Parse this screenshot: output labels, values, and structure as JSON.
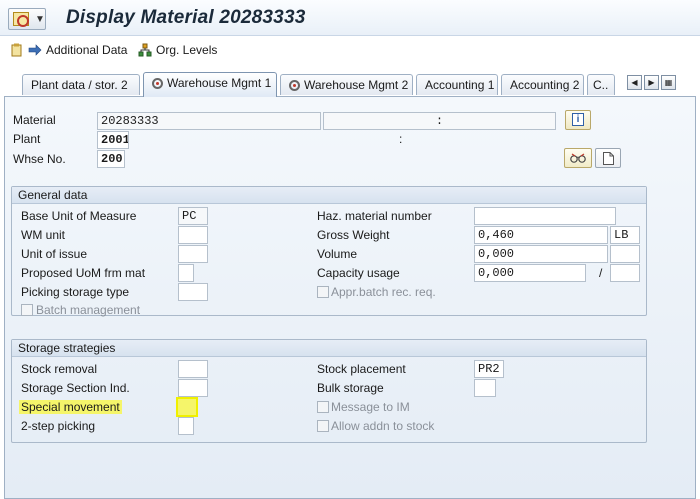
{
  "title": "Display Material 20283333",
  "toolbar": {
    "additional_data": "Additional Data",
    "org_levels": "Org. Levels"
  },
  "tabs": [
    {
      "label": "Plant data / stor. 2",
      "icon": "",
      "active": false
    },
    {
      "label": "Warehouse Mgmt 1",
      "icon": "record-icon",
      "active": true
    },
    {
      "label": "Warehouse Mgmt 2",
      "icon": "record-icon",
      "active": false
    },
    {
      "label": "Accounting 1",
      "icon": "",
      "active": false
    },
    {
      "label": "Accounting 2",
      "icon": "",
      "active": false
    },
    {
      "label": "C..",
      "icon": "",
      "active": false
    }
  ],
  "header": {
    "material_label": "Material",
    "material_value": "20283333",
    "material_desc_sep": ":",
    "plant_label": "Plant",
    "plant_value": "2001",
    "plant_sep": ":",
    "whse_label": "Whse No.",
    "whse_value": "200"
  },
  "general": {
    "title": "General data",
    "base_uom_label": "Base Unit of Measure",
    "base_uom_value": "PC",
    "wm_unit_label": "WM unit",
    "unit_issue_label": "Unit of issue",
    "proposed_uom_label": "Proposed UoM frm mat",
    "picking_type_label": "Picking storage type",
    "batch_mgmt_label": "Batch management",
    "haz_label": "Haz. material number",
    "gross_weight_label": "Gross Weight",
    "gross_weight_value": "0,460",
    "gross_weight_unit": "LB",
    "volume_label": "Volume",
    "volume_value": "0,000",
    "capacity_label": "Capacity usage",
    "capacity_value": "0,000",
    "capacity_sep": "/",
    "appr_batch_label": "Appr.batch rec. req."
  },
  "storage": {
    "title": "Storage strategies",
    "stock_removal_label": "Stock removal",
    "section_ind_label": "Storage Section Ind.",
    "special_movement_label": "Special movement",
    "two_step_label": "2-step picking",
    "stock_placement_label": "Stock placement",
    "stock_placement_value": "PR2",
    "bulk_storage_label": "Bulk storage",
    "message_im_label": "Message to IM",
    "allow_addn_label": "Allow addn to stock"
  },
  "colors": {
    "highlight": "#f5f56a",
    "panel": "#e9f0f7"
  }
}
